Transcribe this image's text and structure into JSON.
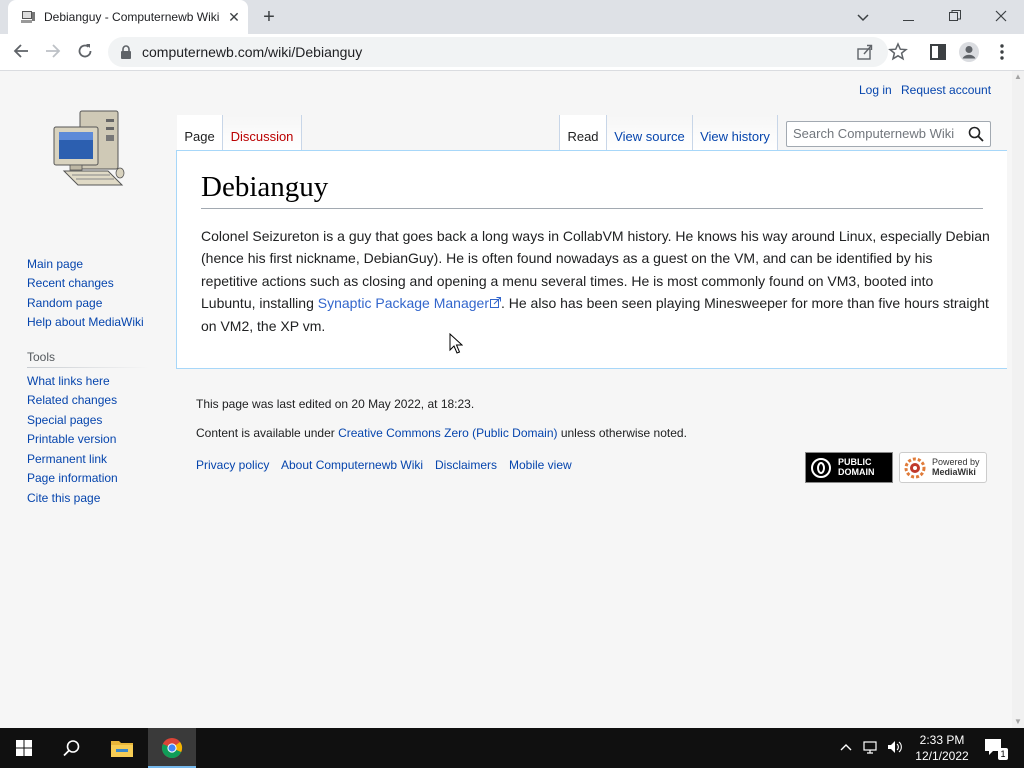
{
  "browser": {
    "tab": {
      "title": "Debianguy - Computernewb Wiki",
      "favicon": "computer-favicon-icon"
    },
    "url": "computernewb.com/wiki/Debianguy",
    "new_tab_label": "+",
    "window_controls": [
      "chevron-down-icon",
      "minimize-icon",
      "restore-icon",
      "close-icon"
    ],
    "toolbar_icons": [
      "share-icon",
      "star-icon",
      "sidepanel-icon",
      "profile-icon",
      "more-icon"
    ]
  },
  "wiki": {
    "personal": {
      "login": "Log in",
      "request_account": "Request account"
    },
    "logo": "computer-logo",
    "tabs": {
      "page": "Page",
      "discussion": "Discussion",
      "read": "Read",
      "view_source": "View source",
      "view_history": "View history"
    },
    "search": {
      "placeholder": "Search Computernewb Wiki"
    },
    "navigation": [
      "Main page",
      "Recent changes",
      "Random page",
      "Help about MediaWiki"
    ],
    "tools": {
      "heading": "Tools",
      "items": [
        "What links here",
        "Related changes",
        "Special pages",
        "Printable version",
        "Permanent link",
        "Page information",
        "Cite this page"
      ]
    },
    "article": {
      "title": "Debianguy",
      "body_before_link": "Colonel Seizureton is a guy that goes back a long ways in CollabVM history. He knows his way around Linux, especially Debian (hence his first nickname, DebianGuy). He is often found nowadays as a guest on the VM, and can be identified by his repetitive actions such as closing and opening a menu several times. He is most commonly found on VM3, booted into Lubuntu, installing ",
      "link_text": "Synaptic Package Manager",
      "body_after_link": ". He also has been seen playing Minesweeper for more than five hours straight on VM2, the XP vm."
    },
    "footer": {
      "last_edited": "This page was last edited on 20 May 2022, at 18:23.",
      "content_before": "Content is available under ",
      "license_link": "Creative Commons Zero (Public Domain)",
      "content_after": " unless otherwise noted.",
      "links": [
        "Privacy policy",
        "About Computernewb Wiki",
        "Disclaimers",
        "Mobile view"
      ],
      "badges": {
        "cc0": {
          "line1": "PUBLIC",
          "line2": "DOMAIN"
        },
        "mediawiki": {
          "line1": "Powered by",
          "line2": "MediaWiki"
        }
      }
    }
  },
  "taskbar": {
    "buttons": [
      "windows-start-icon",
      "search-icon",
      "file-explorer-icon",
      "chrome-icon"
    ],
    "clock": {
      "time": "2:33 PM",
      "date": "12/1/2022"
    },
    "notification_count": "1"
  }
}
